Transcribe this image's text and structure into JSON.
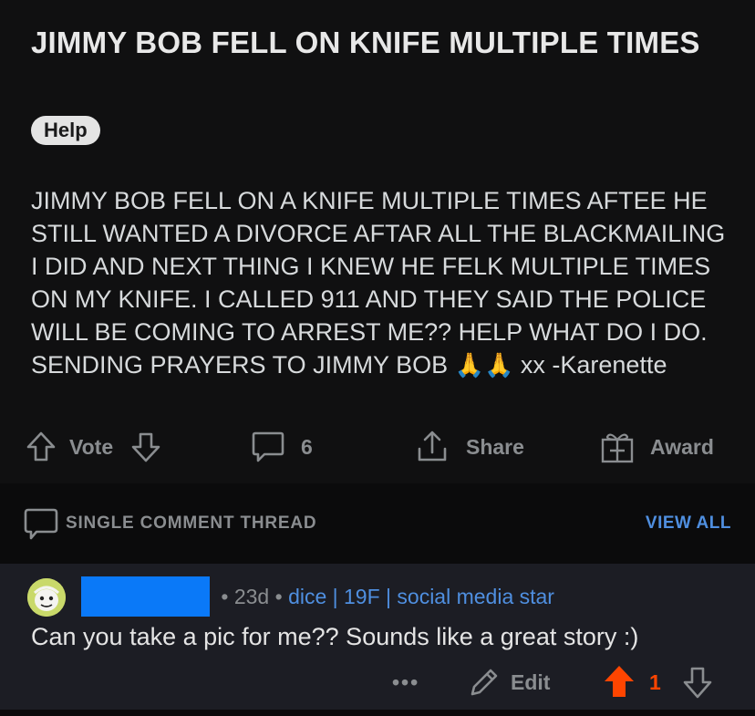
{
  "post": {
    "title": "JIMMY BOB FELL ON KNIFE MULTIPLE TIMES",
    "flair": "Help",
    "body_text": "JIMMY BOB FELL ON A KNIFE MULTIPLE TIMES AFTEE HE STILL WANTED A DIVORCE AFTAR ALL THE BLACKMAILING I DID AND NEXT THING I KNEW HE FELK MULTIPLE TIMES ON MY KNIFE. I CALLED 911 AND THEY SAID THE POLICE WILL BE COMING TO ARREST ME?? HELP WHAT DO I DO. SENDING PRAYERS TO JIMMY BOB",
    "body_emoji": "🙏🙏",
    "body_signoff": "xx -Karenette"
  },
  "actions": {
    "vote_label": "Vote",
    "comments_count": "6",
    "share_label": "Share",
    "award_label": "Award"
  },
  "thread": {
    "label": "SINGLE COMMENT THREAD",
    "view_all": "VIEW ALL"
  },
  "comment": {
    "age": "23d",
    "user_flair": "dice | 19F | social media star",
    "text": "Can you take a pic for me?? Sounds like a great story :)",
    "more": "•••",
    "edit_label": "Edit",
    "score": "1"
  },
  "colors": {
    "background": "#101011",
    "comment_bg": "#1c1d24",
    "accent_blue": "#4f8fe0",
    "upvote": "#ff4500",
    "redaction": "#0a79f8"
  }
}
